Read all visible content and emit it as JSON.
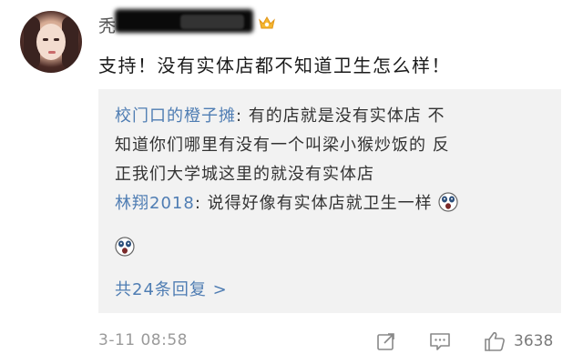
{
  "comment": {
    "user_initial": "秃",
    "text": "支持！没有实体店都不知道卫生怎么样！",
    "timestamp": "3-11 08:58",
    "like_count": "3638"
  },
  "replies": [
    {
      "user": "校门口的橙子摊",
      "separator": ": ",
      "lines": [
        "有的店就是没有实体店 不",
        "知道你们哪里有没有一个叫梁小猴炒饭的 反",
        "正我们大学城这里的就没有实体店"
      ]
    },
    {
      "user": "林翔2018",
      "separator": ": ",
      "text": "说得好像有实体店就卫生一样"
    }
  ],
  "more_replies_label": "共24条回复 >",
  "icons": [
    "vip-crown-icon",
    "share-icon",
    "reply-icon",
    "like-icon",
    "shocked-emoji-icon"
  ]
}
